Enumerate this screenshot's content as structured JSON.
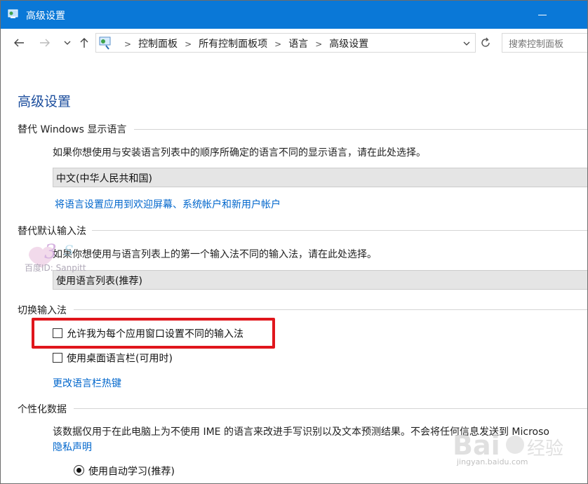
{
  "window": {
    "title": "高级设置",
    "accent_color": "#0a78d7"
  },
  "nav": {
    "back_icon": "arrow-left-icon",
    "forward_icon": "arrow-right-icon",
    "recent_icon": "chevron-down-icon",
    "up_icon": "arrow-up-icon",
    "refresh_icon": "refresh-icon"
  },
  "breadcrumb": {
    "items": [
      "控制面板",
      "所有控制面板项",
      "语言",
      "高级设置"
    ],
    "separator": ">"
  },
  "search": {
    "placeholder": "搜索控制面板"
  },
  "page": {
    "heading": "高级设置"
  },
  "display_language": {
    "title": "替代 Windows 显示语言",
    "description": "如果你想使用与安装语言列表中的顺序所确定的语言不同的显示语言，请在此处选择。",
    "selected": "中文(中华人民共和国)",
    "link": "将语言设置应用到欢迎屏幕、系统帐户和新用户帐户"
  },
  "input_method": {
    "title": "替代默认输入法",
    "description": "如果你想使用与语言列表上的第一个输入法不同的输入法，请在此处选择。",
    "selected": "使用语言列表(推荐)"
  },
  "switching": {
    "title": "切换输入法",
    "option_per_app": "允许我为每个应用窗口设置不同的输入法",
    "option_per_app_checked": false,
    "option_desktop_bar": "使用桌面语言栏(可用时)",
    "option_desktop_bar_checked": false,
    "hotkeys_link": "更改语言栏热键",
    "highlight_color": "#e0161c"
  },
  "personalization": {
    "title": "个性化数据",
    "description": "该数据仅用于在此电脑上为不使用 IME 的语言来改进手写识别以及文本预测结果。不会将任何信息发送到 Microso",
    "privacy_link": "隐私声明",
    "radio_auto": "使用自动学习(推荐)",
    "radio_auto_selected": true
  },
  "watermarks": {
    "left_text": "百度ID: Sanpitt",
    "right_text": "jingyan.baidu.com"
  }
}
